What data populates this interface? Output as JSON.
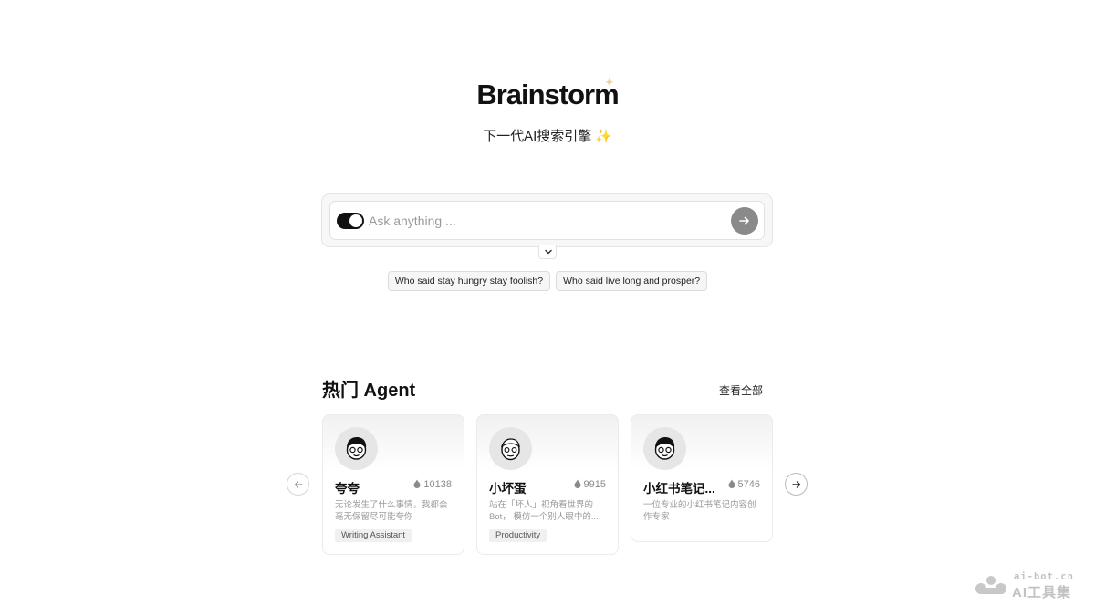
{
  "hero": {
    "title": "Brainstorm",
    "subtitle": "下一代AI搜索引擎",
    "subtitle_emoji": "✨"
  },
  "search": {
    "placeholder": "Ask anything ...",
    "value": "",
    "toggle_on": true,
    "send_icon": "arrow-right-icon",
    "expand_icon": "chevron-down-icon"
  },
  "suggestions": [
    "Who said stay hungry stay foolish?",
    "Who said live long and prosper?"
  ],
  "agents_section": {
    "title": "热门 Agent",
    "view_all": "查看全部",
    "prev_icon": "arrow-left-icon",
    "next_icon": "arrow-right-icon",
    "cards": [
      {
        "name": "夸夸",
        "count": "10138",
        "description": "无论发生了什么事情，我都会毫无保留尽可能夸你",
        "tag": "Writing Assistant"
      },
      {
        "name": "小坏蛋",
        "count": "9915",
        "description": "站在「坏人」视角看世界的 Bot， 模仿一个别人眼中的...",
        "tag": "Productivity"
      },
      {
        "name": "小红书笔记...",
        "count": "5746",
        "description": "一位专业的小红书笔记内容创作专家",
        "tag": ""
      }
    ]
  },
  "watermark": {
    "domain": "ai-bot.cn",
    "text": "AI工具集"
  },
  "colors": {
    "accent": "#111111",
    "send_button": "#8a8a8a",
    "muted_text": "#9a9a9a",
    "sparkle": "#ead7a6"
  }
}
